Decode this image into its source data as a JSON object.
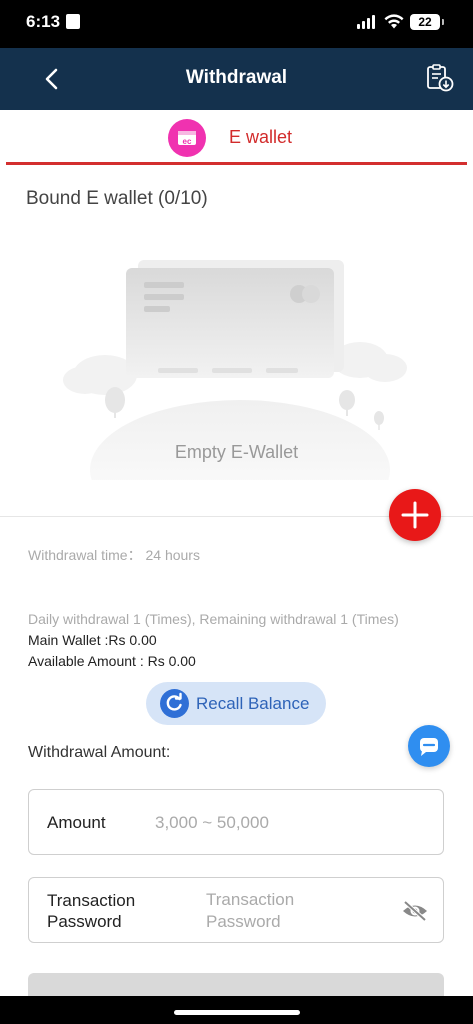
{
  "status_bar": {
    "time": "6:13",
    "battery": "22"
  },
  "nav": {
    "title": "Withdrawal",
    "back_icon": "chevron-left-icon",
    "record_icon": "clipboard-download-icon"
  },
  "tab": {
    "label": "E wallet",
    "icon": "wallet-icon"
  },
  "bound": {
    "title": "Bound E wallet (0/10)"
  },
  "empty": {
    "label": "Empty E-Wallet"
  },
  "info": {
    "withdrawal_time_label": "Withdrawal time：",
    "withdrawal_time_value": "24 hours",
    "daily_withdrawal": "Daily withdrawal 1 (Times), Remaining withdrawal 1 (Times)",
    "main_wallet": "Main Wallet :Rs 0.00",
    "available_amount": "Available Amount : Rs 0.00"
  },
  "recall": {
    "label": "Recall Balance"
  },
  "form": {
    "withdrawal_amount_label": "Withdrawal Amount:",
    "amount_label": "Amount",
    "amount_placeholder": "3,000 ~ 50,000",
    "password_label_line1": "Transaction",
    "password_label_line2": "Password",
    "password_placeholder_line1": "Transaction",
    "password_placeholder_line2": "Password"
  },
  "colors": {
    "header_bg": "#14314d",
    "accent_red": "#d32f2f",
    "wallet_icon": "#f032b0",
    "recall_bg": "#d6e4f7",
    "recall_icon": "#2f6fd6",
    "chat_button": "#2f8ef0"
  }
}
